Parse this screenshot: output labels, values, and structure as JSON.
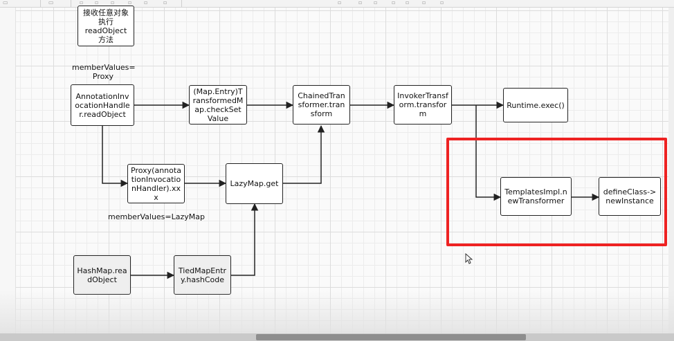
{
  "nodes": {
    "receive_object": "接收任意对象\n执行\nreadObject\n方法",
    "annotation_handler": "AnnotationInvocationHandler.readObject",
    "map_entry": "(Map.Entry)TransformedMap.checkSetValue",
    "chained_transformer": "ChainedTransformer.transform",
    "invoker_transformer": "InvokerTransform.transform",
    "runtime_exec": "Runtime.exec()",
    "proxy": "Proxy(annotationInvocationHandler).xxx",
    "lazymap_get": "LazyMap.get",
    "templates_impl": "TemplatesImpl.newTransformer",
    "define_class": "defineClass->newInstance",
    "hashmap_read": "HashMap.readObject",
    "tiedmap_entry": "TiedMapEntry.hashCode"
  },
  "labels": {
    "member_values_proxy": "memberValues=\nProxy",
    "member_values_lazymap": "memberValues=LazyMap"
  },
  "colors": {
    "highlight": "#ee2222",
    "edge": "#222222",
    "node_border": "#222222"
  }
}
